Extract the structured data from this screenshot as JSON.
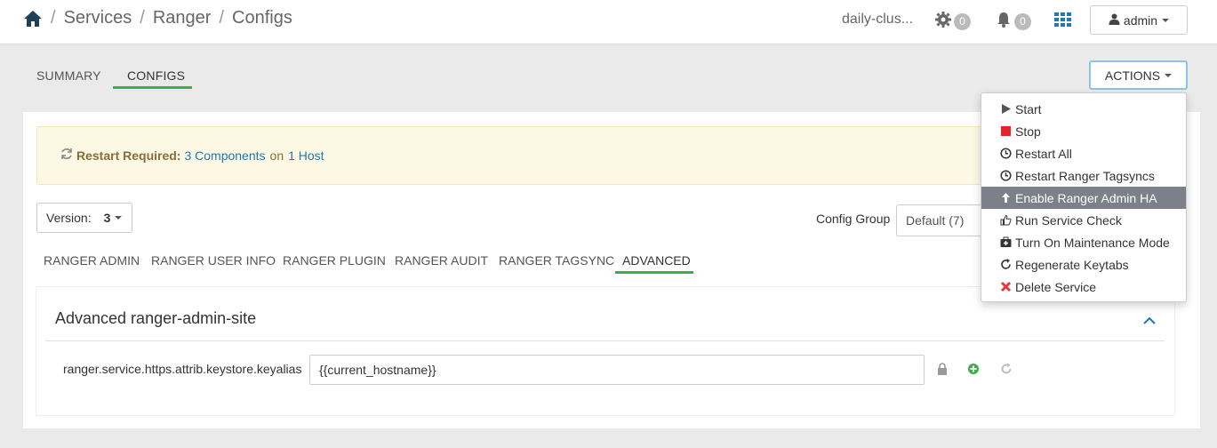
{
  "breadcrumb": {
    "items": [
      "Services",
      "Ranger",
      "Configs"
    ],
    "separator": "/"
  },
  "topbar": {
    "cluster_name": "daily-clus...",
    "settings_count": "0",
    "alerts_count": "0",
    "user_label": "admin"
  },
  "main_tabs": [
    {
      "label": "SUMMARY"
    },
    {
      "label": "CONFIGS",
      "active": true
    }
  ],
  "actions": {
    "button_label": "ACTIONS",
    "menu": [
      {
        "label": "Start",
        "icon": "play-icon"
      },
      {
        "label": "Stop",
        "icon": "stop-icon"
      },
      {
        "label": "Restart All",
        "icon": "clock-icon"
      },
      {
        "label": "Restart Ranger Tagsyncs",
        "icon": "clock-icon"
      },
      {
        "label": "Enable Ranger Admin HA",
        "icon": "arrow-up-icon",
        "highlighted": true
      },
      {
        "label": "Run Service Check",
        "icon": "thumbs-up-icon"
      },
      {
        "label": "Turn On Maintenance Mode",
        "icon": "medkit-icon"
      },
      {
        "label": "Regenerate Keytabs",
        "icon": "refresh-icon"
      },
      {
        "label": "Delete Service",
        "icon": "remove-icon"
      }
    ]
  },
  "alert": {
    "prefix": "Restart Required:",
    "components_link": "3 Components",
    "on": "on",
    "hosts_link": "1 Host"
  },
  "version": {
    "label": "Version:",
    "value": "3"
  },
  "config_group": {
    "label": "Config Group",
    "value": "Default (7)"
  },
  "sub_tabs": [
    {
      "label": "RANGER ADMIN"
    },
    {
      "label": "RANGER USER INFO"
    },
    {
      "label": "RANGER PLUGIN"
    },
    {
      "label": "RANGER AUDIT"
    },
    {
      "label": "RANGER TAGSYNC"
    },
    {
      "label": "ADVANCED",
      "active": true
    }
  ],
  "section": {
    "title": "Advanced ranger-admin-site",
    "property": {
      "name": "ranger.service.https.attrib.keystore.keyalias",
      "value": "{{current_hostname}}"
    }
  },
  "colors": {
    "accent_green": "#3fae49",
    "link_blue": "#1f77b4",
    "alert_bg": "#fcf8e3",
    "highlight_gray": "#7b8089",
    "stop_red": "#e0262b",
    "delete_red": "#e8373b"
  }
}
